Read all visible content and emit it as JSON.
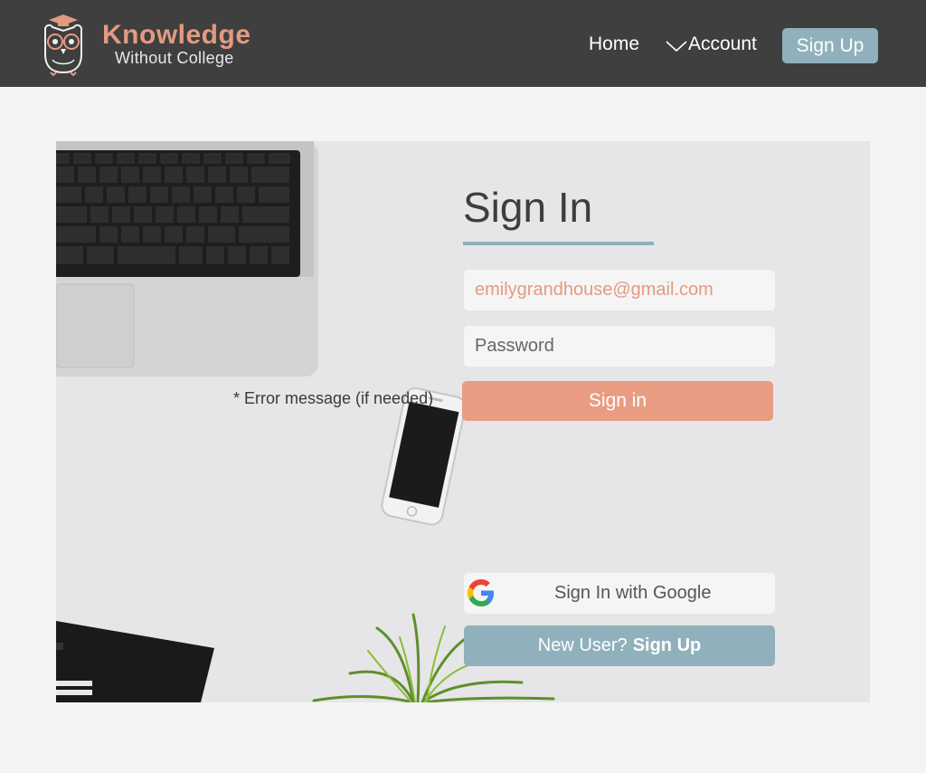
{
  "header": {
    "logo_title": "Knowledge",
    "logo_subtitle": "Without College",
    "nav": {
      "home": "Home",
      "account": "Account"
    },
    "signup_label": "Sign Up"
  },
  "form": {
    "title": "Sign In",
    "email_value": "emilygrandhouse@gmail.com",
    "password_placeholder": "Password",
    "signin_label": "Sign in",
    "error_message": "* Error message (if needed)",
    "google_label": "Sign In with Google",
    "new_user_prefix": "New User?",
    "new_user_link": "Sign Up"
  },
  "icons": {
    "logo": "owl-logo-icon",
    "account_dropdown": "chevron-down-icon",
    "google": "google-icon"
  },
  "colors": {
    "header_bg": "#3f3f3f",
    "accent_salmon": "#e99c82",
    "accent_blue": "#90b1bc",
    "page_bg": "#f4f4f4",
    "card_bg": "#e6e6e8"
  }
}
